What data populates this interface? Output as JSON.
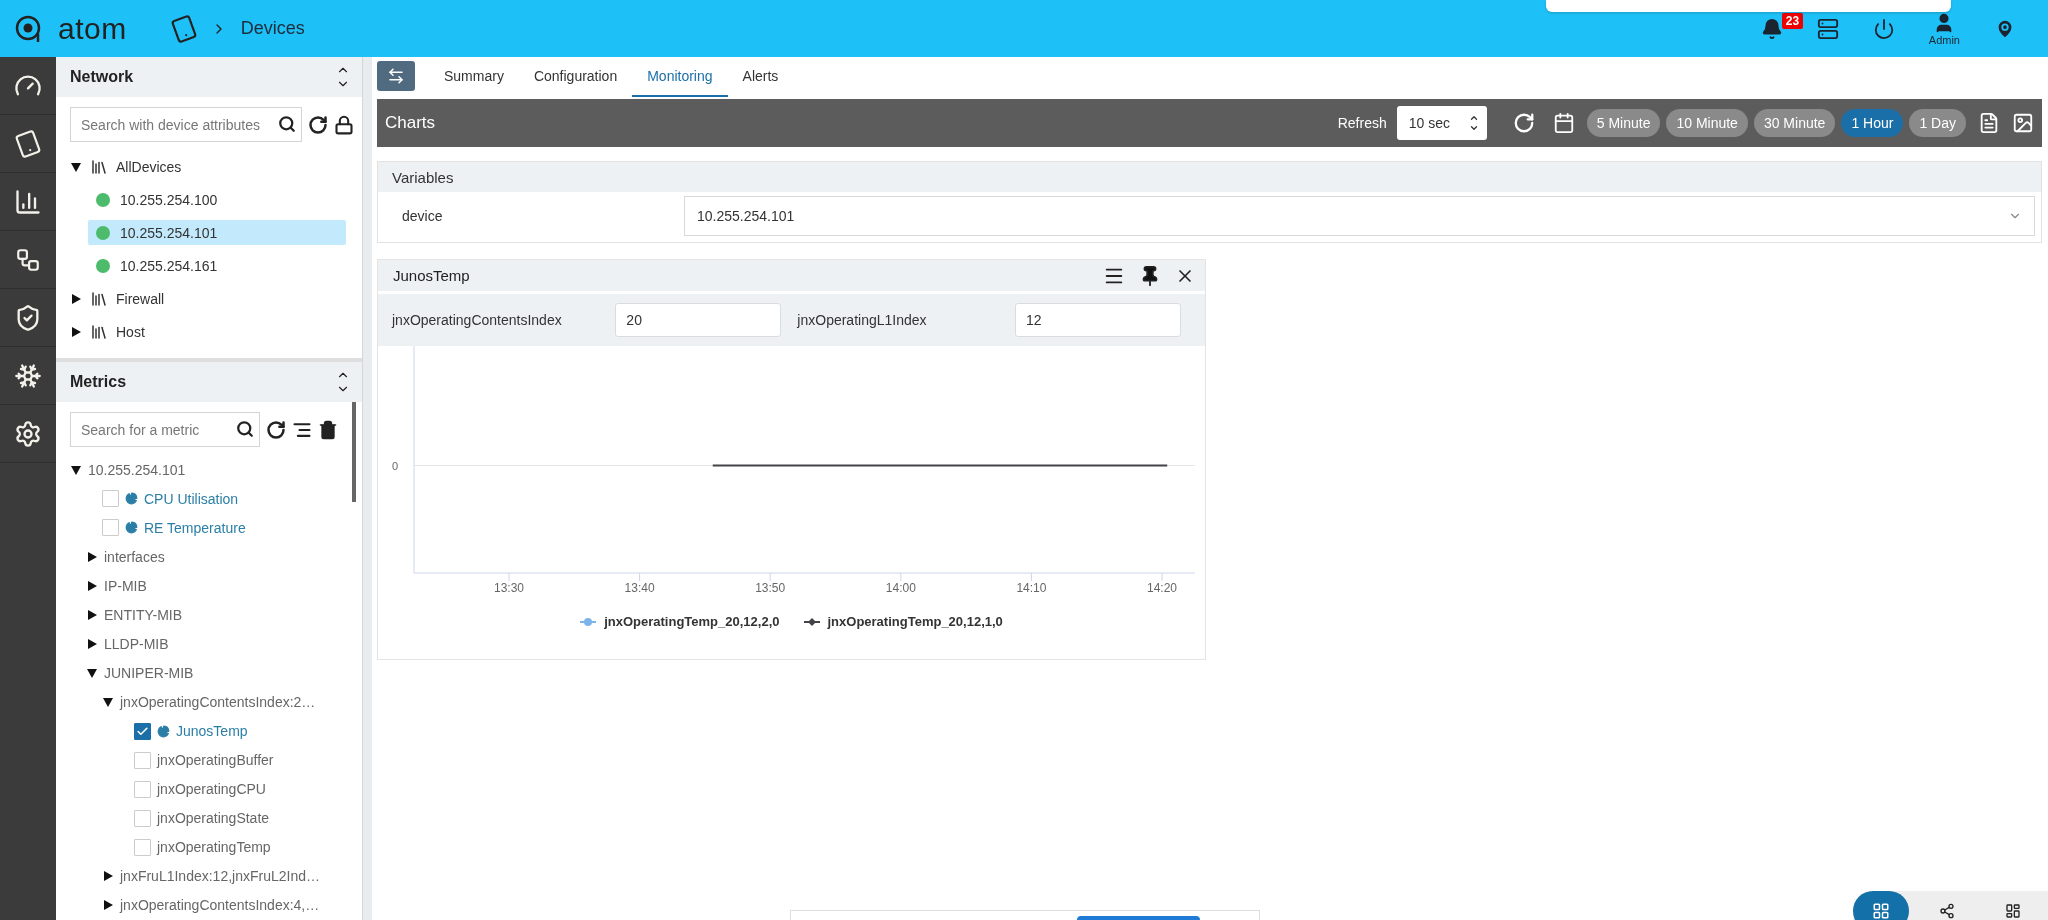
{
  "header": {
    "logo": "atom",
    "breadcrumb": "Devices",
    "notifications": "23",
    "user": "Admin"
  },
  "network": {
    "title": "Network",
    "search_placeholder": "Search with device attributes",
    "tree": [
      {
        "label": "AllDevices",
        "kind": "group",
        "expanded": true,
        "children": [
          {
            "label": "10.255.254.100",
            "kind": "device",
            "color": "#4cbb6c",
            "selected": false
          },
          {
            "label": "10.255.254.101",
            "kind": "device",
            "color": "#4cbb6c",
            "selected": true
          },
          {
            "label": "10.255.254.161",
            "kind": "device",
            "color": "#4cbb6c",
            "selected": false
          }
        ]
      },
      {
        "label": "Firewall",
        "kind": "group",
        "expanded": false
      },
      {
        "label": "Host",
        "kind": "group",
        "expanded": false
      }
    ]
  },
  "metrics": {
    "title": "Metrics",
    "search_placeholder": "Search for a metric",
    "tree": [
      {
        "label": "10.255.254.101",
        "kind": "folder",
        "expanded": true,
        "children": [
          {
            "label": "CPU Utilisation",
            "kind": "chart",
            "checked": false
          },
          {
            "label": "RE Temperature",
            "kind": "chart",
            "checked": false
          },
          {
            "label": "interfaces",
            "kind": "folder",
            "expanded": false
          },
          {
            "label": "IP-MIB",
            "kind": "folder",
            "expanded": false
          },
          {
            "label": "ENTITY-MIB",
            "kind": "folder",
            "expanded": false
          },
          {
            "label": "LLDP-MIB",
            "kind": "folder",
            "expanded": false
          },
          {
            "label": "JUNIPER-MIB",
            "kind": "folder",
            "expanded": true,
            "children": [
              {
                "label": "jnxOperatingContentsIndex:2…",
                "kind": "folder",
                "expanded": true,
                "children": [
                  {
                    "label": "JunosTemp",
                    "kind": "chart",
                    "checked": true
                  },
                  {
                    "label": "jnxOperatingBuffer",
                    "kind": "metric",
                    "checked": false
                  },
                  {
                    "label": "jnxOperatingCPU",
                    "kind": "metric",
                    "checked": false
                  },
                  {
                    "label": "jnxOperatingState",
                    "kind": "metric",
                    "checked": false
                  },
                  {
                    "label": "jnxOperatingTemp",
                    "kind": "metric",
                    "checked": false
                  }
                ]
              },
              {
                "label": "jnxFruL1Index:12,jnxFruL2Ind…",
                "kind": "folder",
                "expanded": false
              },
              {
                "label": "jnxOperatingContentsIndex:4,…",
                "kind": "folder",
                "expanded": false
              }
            ]
          }
        ]
      }
    ]
  },
  "tabs": [
    {
      "label": "Summary",
      "selected": false
    },
    {
      "label": "Configuration",
      "selected": false
    },
    {
      "label": "Monitoring",
      "selected": true
    },
    {
      "label": "Alerts",
      "selected": false
    }
  ],
  "toolbar": {
    "title": "Charts",
    "refresh_label": "Refresh",
    "refresh_value": "10 sec",
    "ranges": [
      {
        "label": "5 Minute",
        "selected": false
      },
      {
        "label": "10 Minute",
        "selected": false
      },
      {
        "label": "30 Minute",
        "selected": false
      },
      {
        "label": "1 Hour",
        "selected": true
      },
      {
        "label": "1 Day",
        "selected": false
      }
    ]
  },
  "variables": {
    "title": "Variables",
    "fields": [
      {
        "label": "device",
        "value": "10.255.254.101"
      }
    ]
  },
  "panel": {
    "title": "JunosTemp",
    "filters": [
      {
        "label": "jnxOperatingContentsIndex",
        "value": "20"
      },
      {
        "label": "jnxOperatingL1Index",
        "value": "12"
      }
    ],
    "chart": {
      "y_axis_label": "0",
      "x_axis_labels": [
        "13:30",
        "13:40",
        "13:50",
        "14:00",
        "14:10",
        "14:20"
      ],
      "legend": [
        {
          "name": "jnxOperatingTemp_20,12,2,0",
          "color": "#7cb5ec"
        },
        {
          "name": "jnxOperatingTemp_20,12,1,0",
          "color": "#434348"
        }
      ]
    }
  }
}
